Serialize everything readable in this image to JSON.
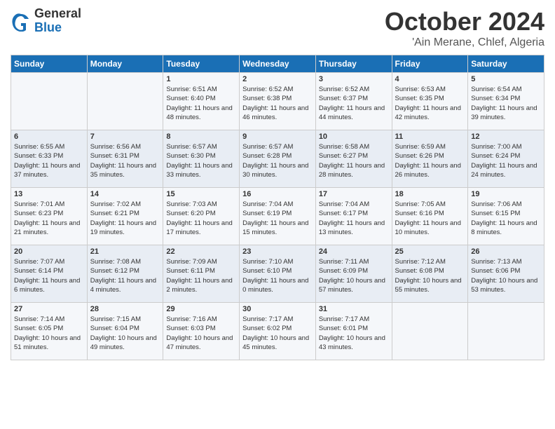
{
  "header": {
    "logo_general": "General",
    "logo_blue": "Blue",
    "title": "October 2024",
    "subtitle": "'Ain Merane, Chlef, Algeria"
  },
  "days_of_week": [
    "Sunday",
    "Monday",
    "Tuesday",
    "Wednesday",
    "Thursday",
    "Friday",
    "Saturday"
  ],
  "weeks": [
    [
      {
        "day": "",
        "info": ""
      },
      {
        "day": "",
        "info": ""
      },
      {
        "day": "1",
        "info": "Sunrise: 6:51 AM\nSunset: 6:40 PM\nDaylight: 11 hours and 48 minutes."
      },
      {
        "day": "2",
        "info": "Sunrise: 6:52 AM\nSunset: 6:38 PM\nDaylight: 11 hours and 46 minutes."
      },
      {
        "day": "3",
        "info": "Sunrise: 6:52 AM\nSunset: 6:37 PM\nDaylight: 11 hours and 44 minutes."
      },
      {
        "day": "4",
        "info": "Sunrise: 6:53 AM\nSunset: 6:35 PM\nDaylight: 11 hours and 42 minutes."
      },
      {
        "day": "5",
        "info": "Sunrise: 6:54 AM\nSunset: 6:34 PM\nDaylight: 11 hours and 39 minutes."
      }
    ],
    [
      {
        "day": "6",
        "info": "Sunrise: 6:55 AM\nSunset: 6:33 PM\nDaylight: 11 hours and 37 minutes."
      },
      {
        "day": "7",
        "info": "Sunrise: 6:56 AM\nSunset: 6:31 PM\nDaylight: 11 hours and 35 minutes."
      },
      {
        "day": "8",
        "info": "Sunrise: 6:57 AM\nSunset: 6:30 PM\nDaylight: 11 hours and 33 minutes."
      },
      {
        "day": "9",
        "info": "Sunrise: 6:57 AM\nSunset: 6:28 PM\nDaylight: 11 hours and 30 minutes."
      },
      {
        "day": "10",
        "info": "Sunrise: 6:58 AM\nSunset: 6:27 PM\nDaylight: 11 hours and 28 minutes."
      },
      {
        "day": "11",
        "info": "Sunrise: 6:59 AM\nSunset: 6:26 PM\nDaylight: 11 hours and 26 minutes."
      },
      {
        "day": "12",
        "info": "Sunrise: 7:00 AM\nSunset: 6:24 PM\nDaylight: 11 hours and 24 minutes."
      }
    ],
    [
      {
        "day": "13",
        "info": "Sunrise: 7:01 AM\nSunset: 6:23 PM\nDaylight: 11 hours and 21 minutes."
      },
      {
        "day": "14",
        "info": "Sunrise: 7:02 AM\nSunset: 6:21 PM\nDaylight: 11 hours and 19 minutes."
      },
      {
        "day": "15",
        "info": "Sunrise: 7:03 AM\nSunset: 6:20 PM\nDaylight: 11 hours and 17 minutes."
      },
      {
        "day": "16",
        "info": "Sunrise: 7:04 AM\nSunset: 6:19 PM\nDaylight: 11 hours and 15 minutes."
      },
      {
        "day": "17",
        "info": "Sunrise: 7:04 AM\nSunset: 6:17 PM\nDaylight: 11 hours and 13 minutes."
      },
      {
        "day": "18",
        "info": "Sunrise: 7:05 AM\nSunset: 6:16 PM\nDaylight: 11 hours and 10 minutes."
      },
      {
        "day": "19",
        "info": "Sunrise: 7:06 AM\nSunset: 6:15 PM\nDaylight: 11 hours and 8 minutes."
      }
    ],
    [
      {
        "day": "20",
        "info": "Sunrise: 7:07 AM\nSunset: 6:14 PM\nDaylight: 11 hours and 6 minutes."
      },
      {
        "day": "21",
        "info": "Sunrise: 7:08 AM\nSunset: 6:12 PM\nDaylight: 11 hours and 4 minutes."
      },
      {
        "day": "22",
        "info": "Sunrise: 7:09 AM\nSunset: 6:11 PM\nDaylight: 11 hours and 2 minutes."
      },
      {
        "day": "23",
        "info": "Sunrise: 7:10 AM\nSunset: 6:10 PM\nDaylight: 11 hours and 0 minutes."
      },
      {
        "day": "24",
        "info": "Sunrise: 7:11 AM\nSunset: 6:09 PM\nDaylight: 10 hours and 57 minutes."
      },
      {
        "day": "25",
        "info": "Sunrise: 7:12 AM\nSunset: 6:08 PM\nDaylight: 10 hours and 55 minutes."
      },
      {
        "day": "26",
        "info": "Sunrise: 7:13 AM\nSunset: 6:06 PM\nDaylight: 10 hours and 53 minutes."
      }
    ],
    [
      {
        "day": "27",
        "info": "Sunrise: 7:14 AM\nSunset: 6:05 PM\nDaylight: 10 hours and 51 minutes."
      },
      {
        "day": "28",
        "info": "Sunrise: 7:15 AM\nSunset: 6:04 PM\nDaylight: 10 hours and 49 minutes."
      },
      {
        "day": "29",
        "info": "Sunrise: 7:16 AM\nSunset: 6:03 PM\nDaylight: 10 hours and 47 minutes."
      },
      {
        "day": "30",
        "info": "Sunrise: 7:17 AM\nSunset: 6:02 PM\nDaylight: 10 hours and 45 minutes."
      },
      {
        "day": "31",
        "info": "Sunrise: 7:17 AM\nSunset: 6:01 PM\nDaylight: 10 hours and 43 minutes."
      },
      {
        "day": "",
        "info": ""
      },
      {
        "day": "",
        "info": ""
      }
    ]
  ]
}
